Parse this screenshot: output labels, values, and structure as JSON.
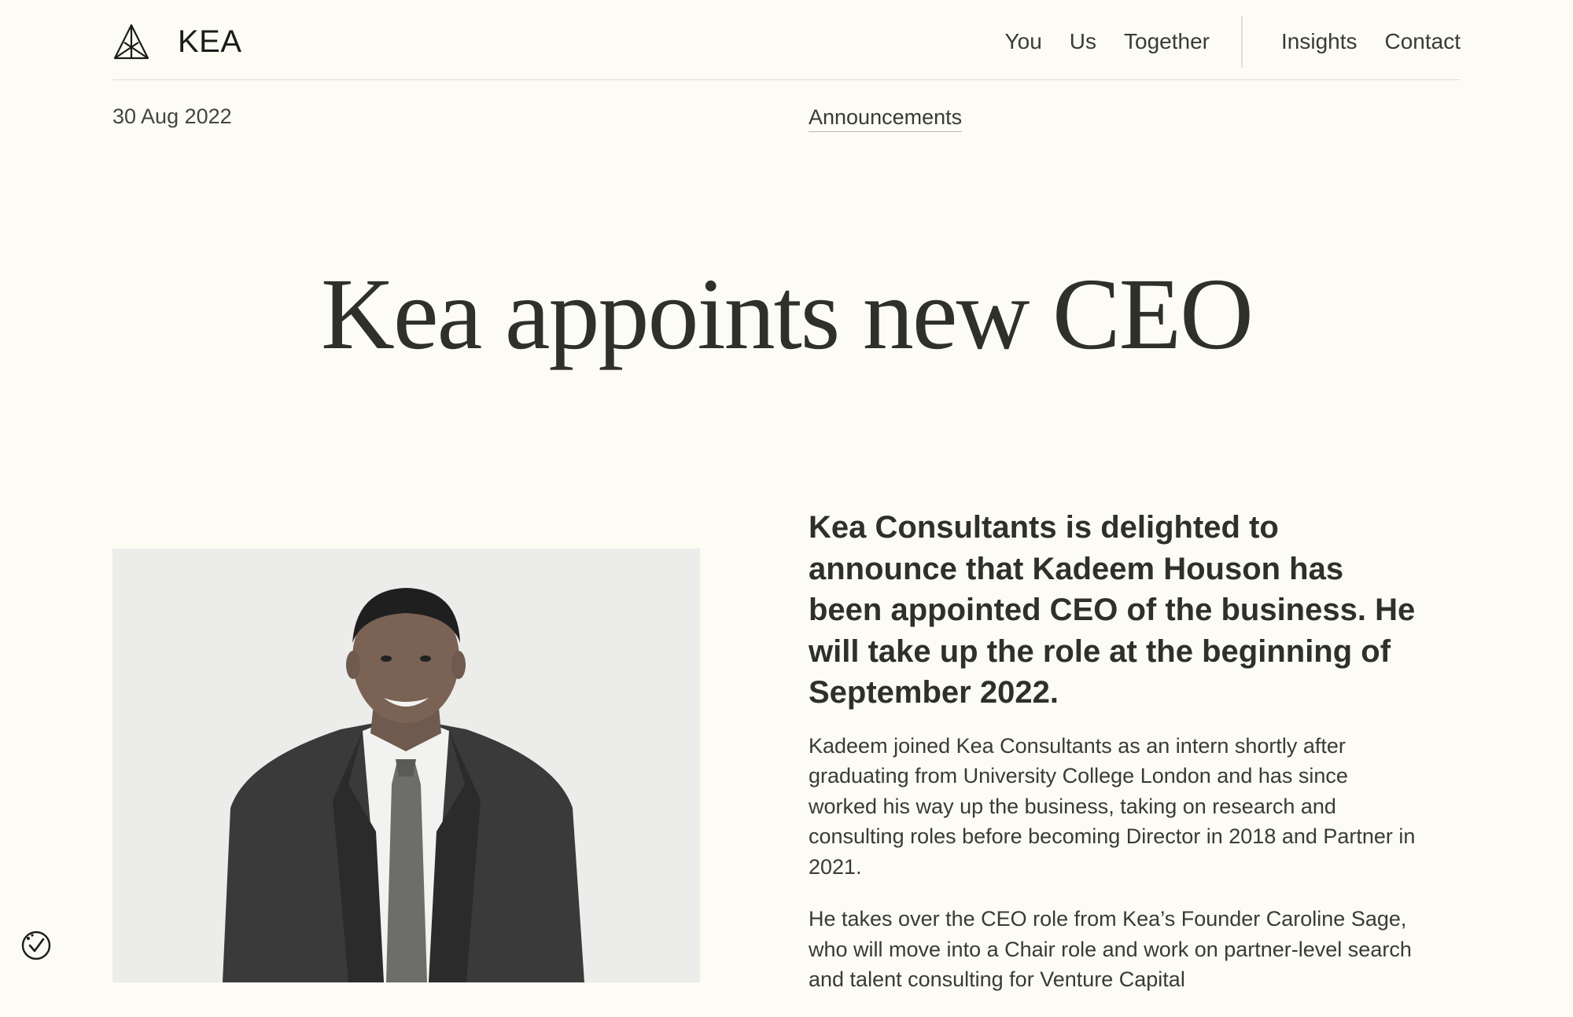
{
  "brand": {
    "name": "KEA"
  },
  "nav": {
    "items": [
      {
        "label": "You"
      },
      {
        "label": "Us"
      },
      {
        "label": "Together"
      },
      {
        "label": "Insights"
      },
      {
        "label": "Contact"
      }
    ]
  },
  "meta": {
    "date": "30 Aug 2022",
    "category": "Announcements"
  },
  "article": {
    "title": "Kea appoints new CEO",
    "lead": "Kea Consultants is delighted to announce that Kadeem Houson has been appointed CEO of the business. He will take up the role at the beginning of September 2022.",
    "paragraphs": [
      "Kadeem joined Kea Consultants as an intern shortly after graduating from University College London and has since worked his way up the business, taking on research and consulting roles before becoming Director in 2018 and Partner in 2021.",
      "He takes over the CEO role from Kea’s Founder Caroline Sage, who will move into a Chair role and work on partner-level search and talent consulting for Venture Capital"
    ]
  },
  "colors": {
    "background": "#fcfbf4",
    "text": "#2f2f2c",
    "divider": "#deded8",
    "photo_background": "#ececea"
  },
  "icons": {
    "logo": "kea-mountain-logo-icon",
    "cookie": "cookie-consent-icon"
  }
}
